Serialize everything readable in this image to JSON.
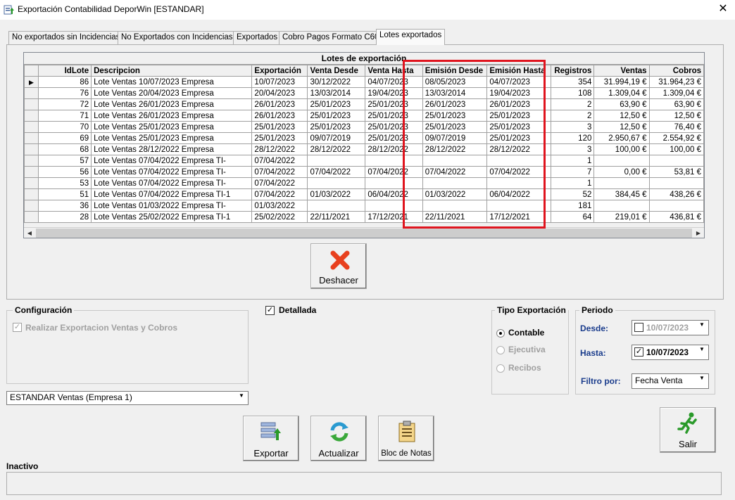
{
  "window": {
    "title": "Exportación Contabilidad DeporWin   [ESTANDAR]",
    "close_glyph": "✕"
  },
  "tabs": [
    {
      "label": "No exportados sin Incidencias"
    },
    {
      "label": "No Exportados con Incidencias"
    },
    {
      "label": "Exportados"
    },
    {
      "label": "Cobro Pagos Formato C60"
    },
    {
      "label": "Lotes exportados"
    }
  ],
  "grid": {
    "caption": "Lotes de exportación",
    "columns": [
      "IdLote",
      "Descripcion",
      "Exportación",
      "Venta Desde",
      "Venta Hasta",
      "Emisión Desde",
      "Emisión Hasta",
      "Registros",
      "Ventas",
      "Cobros"
    ],
    "current_row_glyph": "▶",
    "rows": [
      [
        "86",
        "Lote Ventas 10/07/2023 Empresa",
        "10/07/2023",
        "30/12/2022",
        "04/07/2023",
        "08/05/2023",
        "04/07/2023",
        "354",
        "31.994,19 €",
        "31.964,23 €"
      ],
      [
        "76",
        "Lote Ventas 20/04/2023 Empresa",
        "20/04/2023",
        "13/03/2014",
        "19/04/2023",
        "13/03/2014",
        "19/04/2023",
        "108",
        "1.309,04 €",
        "1.309,04 €"
      ],
      [
        "72",
        "Lote Ventas 26/01/2023 Empresa",
        "26/01/2023",
        "25/01/2023",
        "25/01/2023",
        "26/01/2023",
        "26/01/2023",
        "2",
        "63,90 €",
        "63,90 €"
      ],
      [
        "71",
        "Lote Ventas 26/01/2023 Empresa",
        "26/01/2023",
        "25/01/2023",
        "25/01/2023",
        "25/01/2023",
        "25/01/2023",
        "2",
        "12,50 €",
        "12,50 €"
      ],
      [
        "70",
        "Lote Ventas 25/01/2023 Empresa",
        "25/01/2023",
        "25/01/2023",
        "25/01/2023",
        "25/01/2023",
        "25/01/2023",
        "3",
        "12,50 €",
        "76,40 €"
      ],
      [
        "69",
        "Lote Ventas 25/01/2023 Empresa",
        "25/01/2023",
        "09/07/2019",
        "25/01/2023",
        "09/07/2019",
        "25/01/2023",
        "120",
        "2.950,67 €",
        "2.554,92 €"
      ],
      [
        "68",
        "Lote Ventas 28/12/2022 Empresa",
        "28/12/2022",
        "28/12/2022",
        "28/12/2022",
        "28/12/2022",
        "28/12/2022",
        "3",
        "100,00 €",
        "100,00 €"
      ],
      [
        "57",
        "Lote Ventas 07/04/2022 Empresa TI-",
        "07/04/2022",
        "",
        "",
        "",
        "",
        "1",
        "",
        ""
      ],
      [
        "56",
        "Lote Ventas 07/04/2022 Empresa TI-",
        "07/04/2022",
        "07/04/2022",
        "07/04/2022",
        "07/04/2022",
        "07/04/2022",
        "7",
        "0,00 €",
        "53,81 €"
      ],
      [
        "53",
        "Lote Ventas 07/04/2022 Empresa TI-",
        "07/04/2022",
        "",
        "",
        "",
        "",
        "1",
        "",
        ""
      ],
      [
        "51",
        "Lote Ventas 07/04/2022 Empresa TI-1",
        "07/04/2022",
        "01/03/2022",
        "06/04/2022",
        "01/03/2022",
        "06/04/2022",
        "52",
        "384,45 €",
        "438,26 €"
      ],
      [
        "36",
        "Lote Ventas 01/03/2022 Empresa TI-",
        "01/03/2022",
        "",
        "",
        "",
        "",
        "181",
        "",
        ""
      ],
      [
        "28",
        "Lote Ventas 25/02/2022 Empresa TI-1",
        "25/02/2022",
        "22/11/2021",
        "17/12/2021",
        "22/11/2021",
        "17/12/2021",
        "64",
        "219,01 €",
        "436,81 €"
      ]
    ]
  },
  "buttons": {
    "deshacer": "Deshacer",
    "exportar": "Exportar",
    "actualizar": "Actualizar",
    "bloc_notas": "Bloc de Notas",
    "salir": "Salir"
  },
  "configuracion": {
    "title": "Configuración",
    "checkbox_label": "Realizar Exportacion Ventas y Cobros",
    "checked": true
  },
  "detallada": {
    "label": "Detallada",
    "checked": true
  },
  "profile_select": {
    "value": "ESTANDAR Ventas (Empresa 1)"
  },
  "tipo_exportacion": {
    "title": "Tipo Exportación",
    "options": [
      "Contable",
      "Ejecutiva",
      "Recibos"
    ],
    "selected": "Contable"
  },
  "periodo": {
    "title": "Periodo",
    "desde_label": "Desde:",
    "desde_value": "10/07/2023",
    "desde_checked": false,
    "hasta_label": "Hasta:",
    "hasta_value": "10/07/2023",
    "hasta_checked": true,
    "filtro_label": "Filtro por:",
    "filtro_value": "Fecha Venta"
  },
  "status": {
    "label": "Inactivo"
  },
  "colors": {
    "highlight": "#e0141e",
    "link_blue": "#1a3c8c"
  }
}
